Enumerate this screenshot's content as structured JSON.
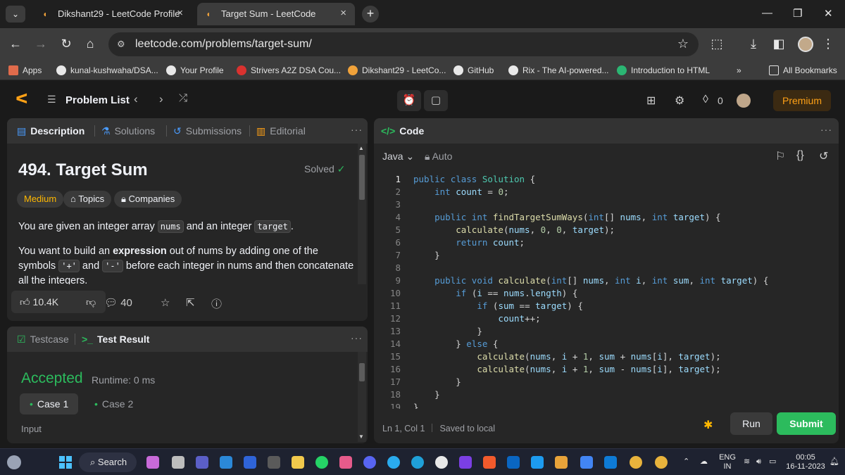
{
  "browser": {
    "tabs": [
      {
        "title": "Dikshant29 - LeetCode Profile",
        "active": false
      },
      {
        "title": "Target Sum - LeetCode",
        "active": true
      }
    ],
    "url": "leetcode.com/problems/target-sum/",
    "bookmarks": [
      "Apps",
      "kunal-kushwaha/DSA...",
      "Your Profile",
      "Strivers A2Z DSA Cou...",
      "Dikshant29 - LeetCo...",
      "GitHub",
      "Rix - The AI-powered...",
      "Introduction to HTML",
      "All Bookmarks"
    ],
    "bookmark_overflow": "»"
  },
  "lcnav": {
    "problem_list": "Problem List",
    "streak_count": "0",
    "premium": "Premium"
  },
  "left_tabs": {
    "description": "Description",
    "solutions": "Solutions",
    "submissions": "Submissions",
    "editorial": "Editorial"
  },
  "problem": {
    "title": "494. Target Sum",
    "solved": "Solved",
    "difficulty": "Medium",
    "topics": "Topics",
    "companies": "Companies",
    "p1_a": "You are given an integer array ",
    "p1_code1": "nums",
    "p1_b": " and an integer ",
    "p1_code2": "target",
    "p1_c": ".",
    "p2_a": "You want to build an ",
    "p2_bold": "expression",
    "p2_b": " out of nums by adding one of the symbols ",
    "p2_code1": "'+'",
    "p2_c": " and ",
    "p2_code2": "'-'",
    "p2_d": " before each integer in nums and then concatenate all the integers.",
    "likes": "10.4K",
    "comments": "40"
  },
  "testpanel": {
    "testcase": "Testcase",
    "test_result": "Test Result",
    "verdict": "Accepted",
    "runtime": "Runtime: 0 ms",
    "case1": "Case 1",
    "case2": "Case 2",
    "input_label": "Input"
  },
  "editor": {
    "header": "Code",
    "language": "Java",
    "mode": "Auto",
    "status_pos": "Ln 1, Col 1",
    "status_save": "Saved to local",
    "run": "Run",
    "submit": "Submit",
    "code_lines": [
      "public class Solution {",
      "    int count = 0;",
      "",
      "    public int findTargetSumWays(int[] nums, int target) {",
      "        calculate(nums, 0, 0, target);",
      "        return count;",
      "    }",
      "",
      "    public void calculate(int[] nums, int i, int sum, int target) {",
      "        if (i == nums.length) {",
      "            if (sum == target) {",
      "                count++;",
      "            }",
      "        } else {",
      "            calculate(nums, i + 1, sum + nums[i], target);",
      "            calculate(nums, i + 1, sum - nums[i], target);",
      "        }",
      "    }",
      "}"
    ]
  },
  "taskbar": {
    "search": "Search",
    "lang_top": "ENG",
    "lang_bottom": "IN",
    "time": "00:05",
    "date": "16-11-2023"
  },
  "colors": {
    "accent": "#ffa116",
    "accepted": "#2cbb5d",
    "medium": "#ffb800",
    "panel": "#262626"
  }
}
